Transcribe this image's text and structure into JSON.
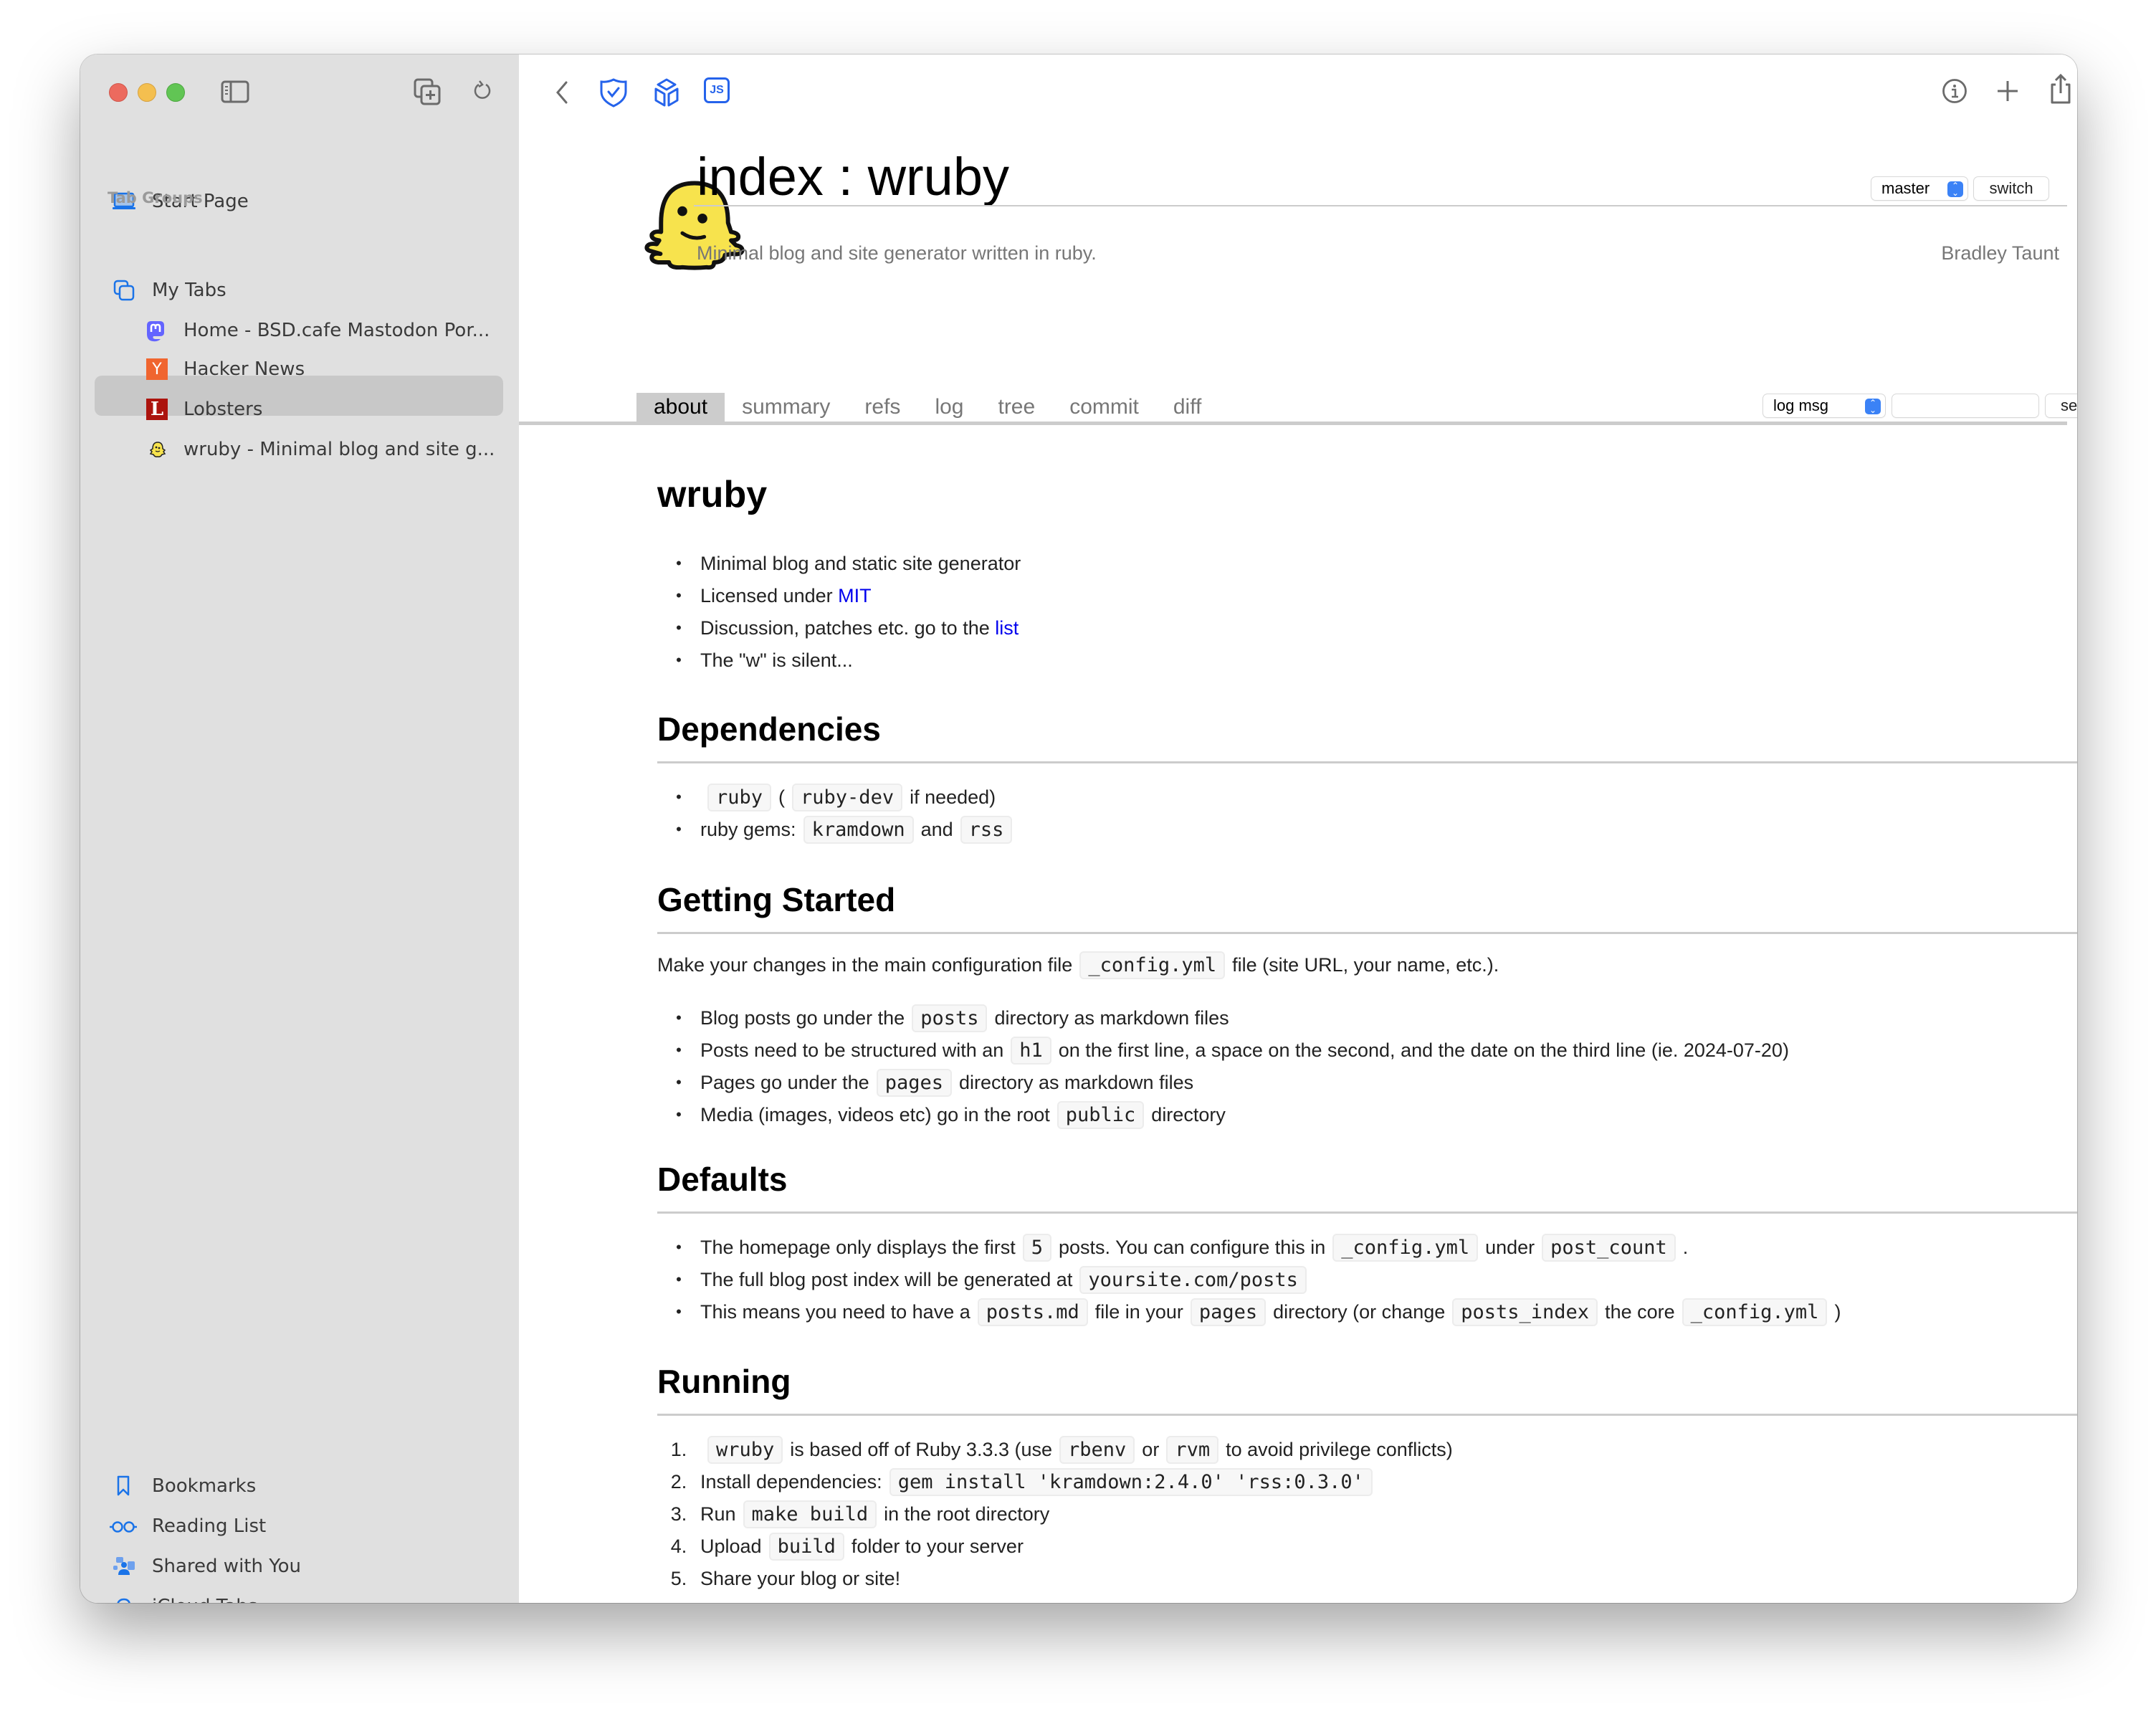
{
  "sidebar": {
    "start_page": "Start Page",
    "section_label": "Tab Groups",
    "group": "My Tabs",
    "tabs": [
      {
        "title": "Home - BSD.cafe Mastodon Por...",
        "icon": "mastodon-icon",
        "selected": false
      },
      {
        "title": "Hacker News",
        "icon": "hacker-news-icon",
        "favicon_text": "Y",
        "selected": false
      },
      {
        "title": "Lobsters",
        "icon": "lobsters-icon",
        "favicon_text": "L",
        "selected": false
      },
      {
        "title": "wruby - Minimal blog and site g...",
        "icon": "wruby-icon",
        "selected": true
      }
    ],
    "footer": [
      {
        "label": "Bookmarks",
        "icon": "bookmark-icon"
      },
      {
        "label": "Reading List",
        "icon": "reading-list-icon"
      },
      {
        "label": "Shared with You",
        "icon": "shared-with-you-icon"
      },
      {
        "label": "iCloud Tabs",
        "icon": "icloud-icon"
      }
    ]
  },
  "toolbar": {
    "extension_js_label": "JS"
  },
  "colors": {
    "accent": "#1a73e8",
    "link": "#0000ee",
    "hn_orange": "#f0652f",
    "lobsters_red": "#ac130d",
    "mastodon_purple": "#6364ff"
  },
  "page": {
    "title": "index : wruby",
    "description": "Minimal blog and site generator written in ruby.",
    "owner": "Bradley Taunt",
    "branch": "master",
    "switch_label": "switch",
    "tabs": [
      "about",
      "summary",
      "refs",
      "log",
      "tree",
      "commit",
      "diff"
    ],
    "active_tab": "about",
    "search_mode": "log msg",
    "search_value": "",
    "search_label": "search"
  },
  "readme": {
    "h1": "wruby",
    "intro": {
      "i1": "Minimal blog and static site generator",
      "i2_pre": "Licensed under ",
      "i2_link": "MIT",
      "i3_pre": "Discussion, patches etc. go to the ",
      "i3_link": "list",
      "i4": "The \"w\" is silent..."
    },
    "deps": {
      "heading": "Dependencies",
      "d1_code1": "ruby",
      "d1_mid": "(",
      "d1_code2": "ruby-dev",
      "d1_post": "if needed)",
      "d2_pre": "ruby gems:",
      "d2_code1": "kramdown",
      "d2_mid": "and",
      "d2_code2": "rss"
    },
    "start": {
      "heading": "Getting Started",
      "p_pre": "Make your changes in the main configuration file",
      "p_code": "_config.yml",
      "p_post": "file (site URL, your name, etc.).",
      "b1_pre": "Blog posts go under the",
      "b1_code": "posts",
      "b1_post": "directory as markdown files",
      "b2_pre": "Posts need to be structured with an",
      "b2_code": "h1",
      "b2_post": "on the first line, a space on the second, and the date on the third line (ie. 2024-07-20)",
      "b3_pre": "Pages go under the",
      "b3_code": "pages",
      "b3_post": "directory as markdown files",
      "b4_pre": "Media (images, videos etc) go in the root",
      "b4_code": "public",
      "b4_post": "directory"
    },
    "defaults": {
      "heading": "Defaults",
      "b1_pre": "The homepage only displays the first",
      "b1_code1": "5",
      "b1_mid": "posts. You can configure this in",
      "b1_code2": "_config.yml",
      "b1_mid2": "under",
      "b1_code3": "post_count",
      "b1_post": ".",
      "b2_pre": "The full blog post index will be generated at",
      "b2_code": "yoursite.com/posts",
      "b3_pre": "This means you need to have a",
      "b3_code1": "posts.md",
      "b3_mid": "file in your",
      "b3_code2": "pages",
      "b3_mid2": "directory (or change",
      "b3_code3": "posts_index",
      "b3_mid3": "the core",
      "b3_code4": "_config.yml",
      "b3_post": ")"
    },
    "running": {
      "heading": "Running",
      "s1_num": "1.",
      "s1_code1": "wruby",
      "s1_mid": "is based off of Ruby 3.3.3 (use",
      "s1_code2": "rbenv",
      "s1_mid2": "or",
      "s1_code3": "rvm",
      "s1_post": "to avoid privilege conflicts)",
      "s2_num": "2.",
      "s2_pre": "Install dependencies:",
      "s2_code": "gem install 'kramdown:2.4.0' 'rss:0.3.0'",
      "s3_num": "3.",
      "s3_pre": "Run",
      "s3_code": "make build",
      "s3_post": "in the root directory",
      "s4_num": "4.",
      "s4_pre": "Upload",
      "s4_code": "build",
      "s4_post": "folder to your server",
      "s5_num": "5.",
      "s5_pre": "Share your blog or site!"
    }
  }
}
